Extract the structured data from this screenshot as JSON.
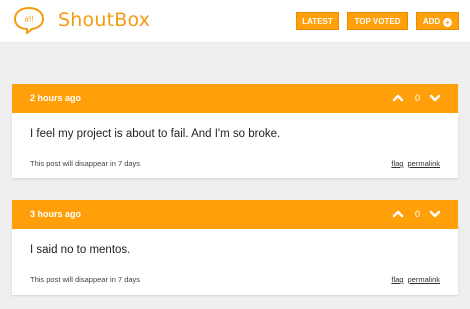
{
  "header": {
    "logo_text": "#!!",
    "brand": "ShoutBox",
    "nav": {
      "latest": "LATEST",
      "top_voted": "TOP VOTED",
      "add": "ADD"
    },
    "accent_color": "#ff9f0a"
  },
  "posts": [
    {
      "time": "2 hours ago",
      "votes": "0",
      "text": "I feel my project is about to fail. And I'm so broke.",
      "note": "This post will disappear in 7 days",
      "flag": "flag",
      "permalink": "permalink"
    },
    {
      "time": "3 hours ago",
      "votes": "0",
      "text": "I said no to mentos.",
      "note": "This post will disappear in 7 days",
      "flag": "flag",
      "permalink": "permalink"
    }
  ]
}
